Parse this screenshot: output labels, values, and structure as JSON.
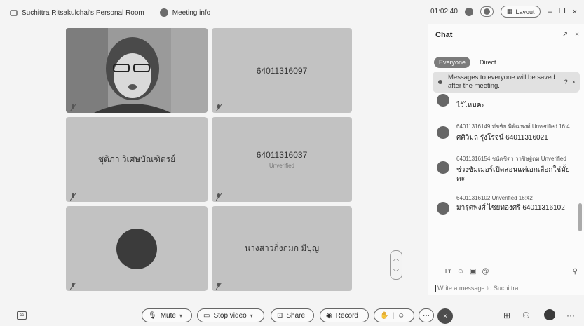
{
  "titlebar": {
    "room_name": "Suchittra Ritsakulchai's Personal Room",
    "meeting_info": "Meeting info",
    "timer": "01:02:40",
    "layout_label": "Layout"
  },
  "tiles": [
    {
      "name": ""
    },
    {
      "name": "64011316097"
    },
    {
      "name": "ชุติภา วิเศษบัณฑิตรย์"
    },
    {
      "name": "64011316037",
      "sub": "Unverified"
    },
    {
      "name": ""
    },
    {
      "name": "นางสาวกิ่งกมก มีบุญ"
    }
  ],
  "chat": {
    "title": "Chat",
    "tabs": [
      "Everyone",
      "Direct"
    ],
    "notice": "Messages to everyone will be saved after the meeting.",
    "messages": [
      {
        "meta": "",
        "body": "ไว้ไหมคะ"
      },
      {
        "meta": "64011316149 ทัชชัย พิพัฒพงศ์ Unverified 16:4",
        "body": "ศศิวิมล รุ่งโรจน์ 64011316021"
      },
      {
        "meta": "64011316154 ชนัดชิดา วาชิษฐ์ดม Unverified",
        "body": "ช่วงซัมเมอร์เปิดสอนแค่เอกเลือกใช่มั้ยคะ"
      },
      {
        "meta": "64011316102 Unverified 16:42",
        "body": "มารุตพงศ์ ไชยทองศรี 64011316102"
      }
    ],
    "input_placeholder": "Write a message to Suchittra"
  },
  "controls": {
    "mute": "Mute",
    "stop_video": "Stop video",
    "share": "Share",
    "record": "Record"
  }
}
